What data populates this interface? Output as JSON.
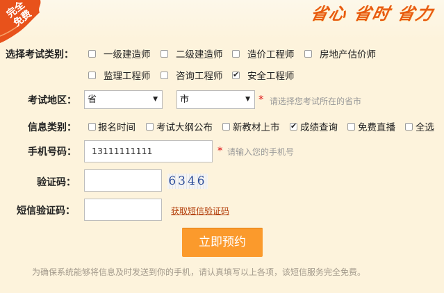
{
  "badge": {
    "line1": "完全",
    "line2": "免费"
  },
  "slogan": "省心 省时 省力",
  "exam_type": {
    "label": "选择考试类别：",
    "options": [
      {
        "label": "一级建造师",
        "checked": false
      },
      {
        "label": "二级建造师",
        "checked": false
      },
      {
        "label": "造价工程师",
        "checked": false
      },
      {
        "label": "房地产估价师",
        "checked": false
      },
      {
        "label": "监理工程师",
        "checked": false
      },
      {
        "label": "咨询工程师",
        "checked": false
      },
      {
        "label": "安全工程师",
        "checked": true
      }
    ]
  },
  "region": {
    "label": "考试地区：",
    "province": "省",
    "city": "市",
    "hint": "请选择您考试所在的省市"
  },
  "info_type": {
    "label": "信息类别：",
    "options": [
      {
        "label": "报名时间",
        "checked": false
      },
      {
        "label": "考试大纲公布",
        "checked": false
      },
      {
        "label": "新教材上市",
        "checked": false
      },
      {
        "label": "成绩查询",
        "checked": true
      },
      {
        "label": "免费直播",
        "checked": false
      },
      {
        "label": "全选",
        "checked": false
      }
    ]
  },
  "phone": {
    "label": "手机号码：",
    "value": "13111111111",
    "hint": "请输入您的手机号"
  },
  "captcha": {
    "label": "验证码：",
    "value": "",
    "image_text": "6346"
  },
  "sms": {
    "label": "短信验证码：",
    "value": "",
    "link": "获取短信验证码"
  },
  "submit": "立即预约",
  "note": "为确保系统能够将信息及时发送到你的手机，请认真填写以上各项，该短信服务完全免费。",
  "required_mark": "*",
  "colors": {
    "accent": "#fb9a2c",
    "badge": "#e8521b",
    "background": "#fdf3dc",
    "required": "#dd1111"
  }
}
